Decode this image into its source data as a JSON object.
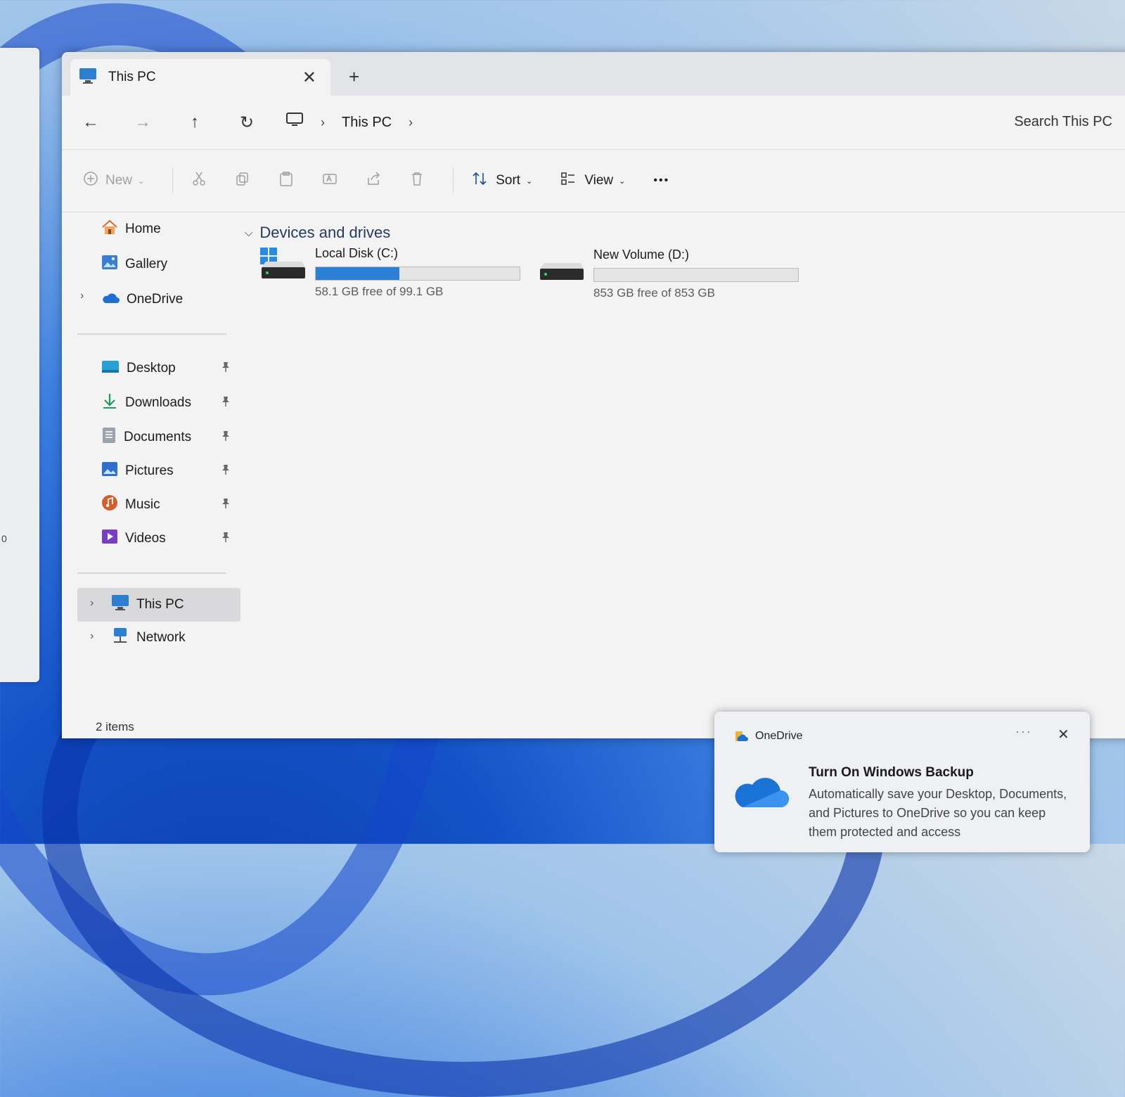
{
  "desktop": {
    "side_window_text": "0"
  },
  "explorer": {
    "tab": {
      "title": "This PC",
      "close_glyph": "✕",
      "new_tab_glyph": "+"
    },
    "nav": {
      "back": "←",
      "forward": "→",
      "up": "↑",
      "refresh": "↻"
    },
    "breadcrumb": {
      "location": "This PC",
      "separator": "›"
    },
    "search": {
      "placeholder": "Search This PC"
    },
    "toolbar": {
      "new_label": "New",
      "sort_label": "Sort",
      "view_label": "View",
      "more_glyph": "•••",
      "caret_glyph": "⌄"
    },
    "sidebar": {
      "home": "Home",
      "gallery": "Gallery",
      "onedrive": "OneDrive",
      "quick_access": [
        "Desktop",
        "Downloads",
        "Documents",
        "Pictures",
        "Music",
        "Videos"
      ],
      "this_pc": "This PC",
      "network": "Network",
      "expand_glyph": "›",
      "pin_glyph": "📌"
    },
    "content": {
      "group_header": "Devices and drives",
      "drives": [
        {
          "name": "Local Disk (C:)",
          "free_text": "58.1 GB free of 99.1 GB",
          "used_fraction": 0.41
        },
        {
          "name": "New Volume (D:)",
          "free_text": "853 GB free of 853 GB",
          "used_fraction": 0.0
        }
      ]
    },
    "status": {
      "item_count": "2 items"
    }
  },
  "toast": {
    "app_name": "OneDrive",
    "more_glyph": "···",
    "close_glyph": "✕",
    "title": "Turn On Windows Backup",
    "body": "Automatically save your Desktop, Documents, and Pictures to OneDrive so you can keep them protected and access"
  },
  "colors": {
    "accent": "#2a7fd6",
    "selection": "#d9d9db",
    "header_text": "#243a5e"
  }
}
